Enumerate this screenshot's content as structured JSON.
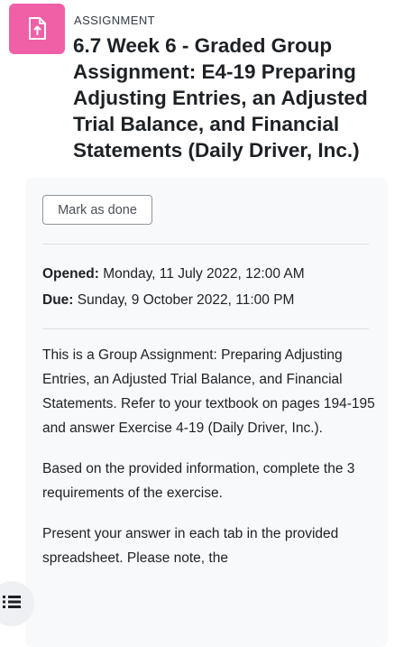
{
  "header": {
    "activity_icon": "assignment-upload-icon",
    "activity_icon_color": "#f060a7",
    "activity_type": "ASSIGNMENT",
    "title": "6.7 Week 6 - Graded Group Assignment: E4-19 Preparing Adjusting Entries, an Adjusted Trial Balance, and Financial Statements (Daily Driver, Inc.)"
  },
  "completion": {
    "mark_done_label": "Mark as done"
  },
  "dates": {
    "opened_label": "Opened:",
    "opened_value": "Monday, 11 July 2022, 12:00 AM",
    "due_label": "Due:",
    "due_value": "Sunday, 9 October 2022, 11:00 PM"
  },
  "description": {
    "paragraphs": [
      "This is a Group Assignment: Preparing Adjusting Entries, an Adjusted Trial Balance, and Financial Statements. Refer to your textbook on pages 194-195 and answer Exercise 4-19 (Daily Driver, Inc.).",
      "Based on the provided information, complete the 3 requirements of the exercise.",
      "Present your answer in each tab in the provided spreadsheet. Please note, the"
    ]
  },
  "drawer_toggle": {
    "icon": "list-icon"
  }
}
